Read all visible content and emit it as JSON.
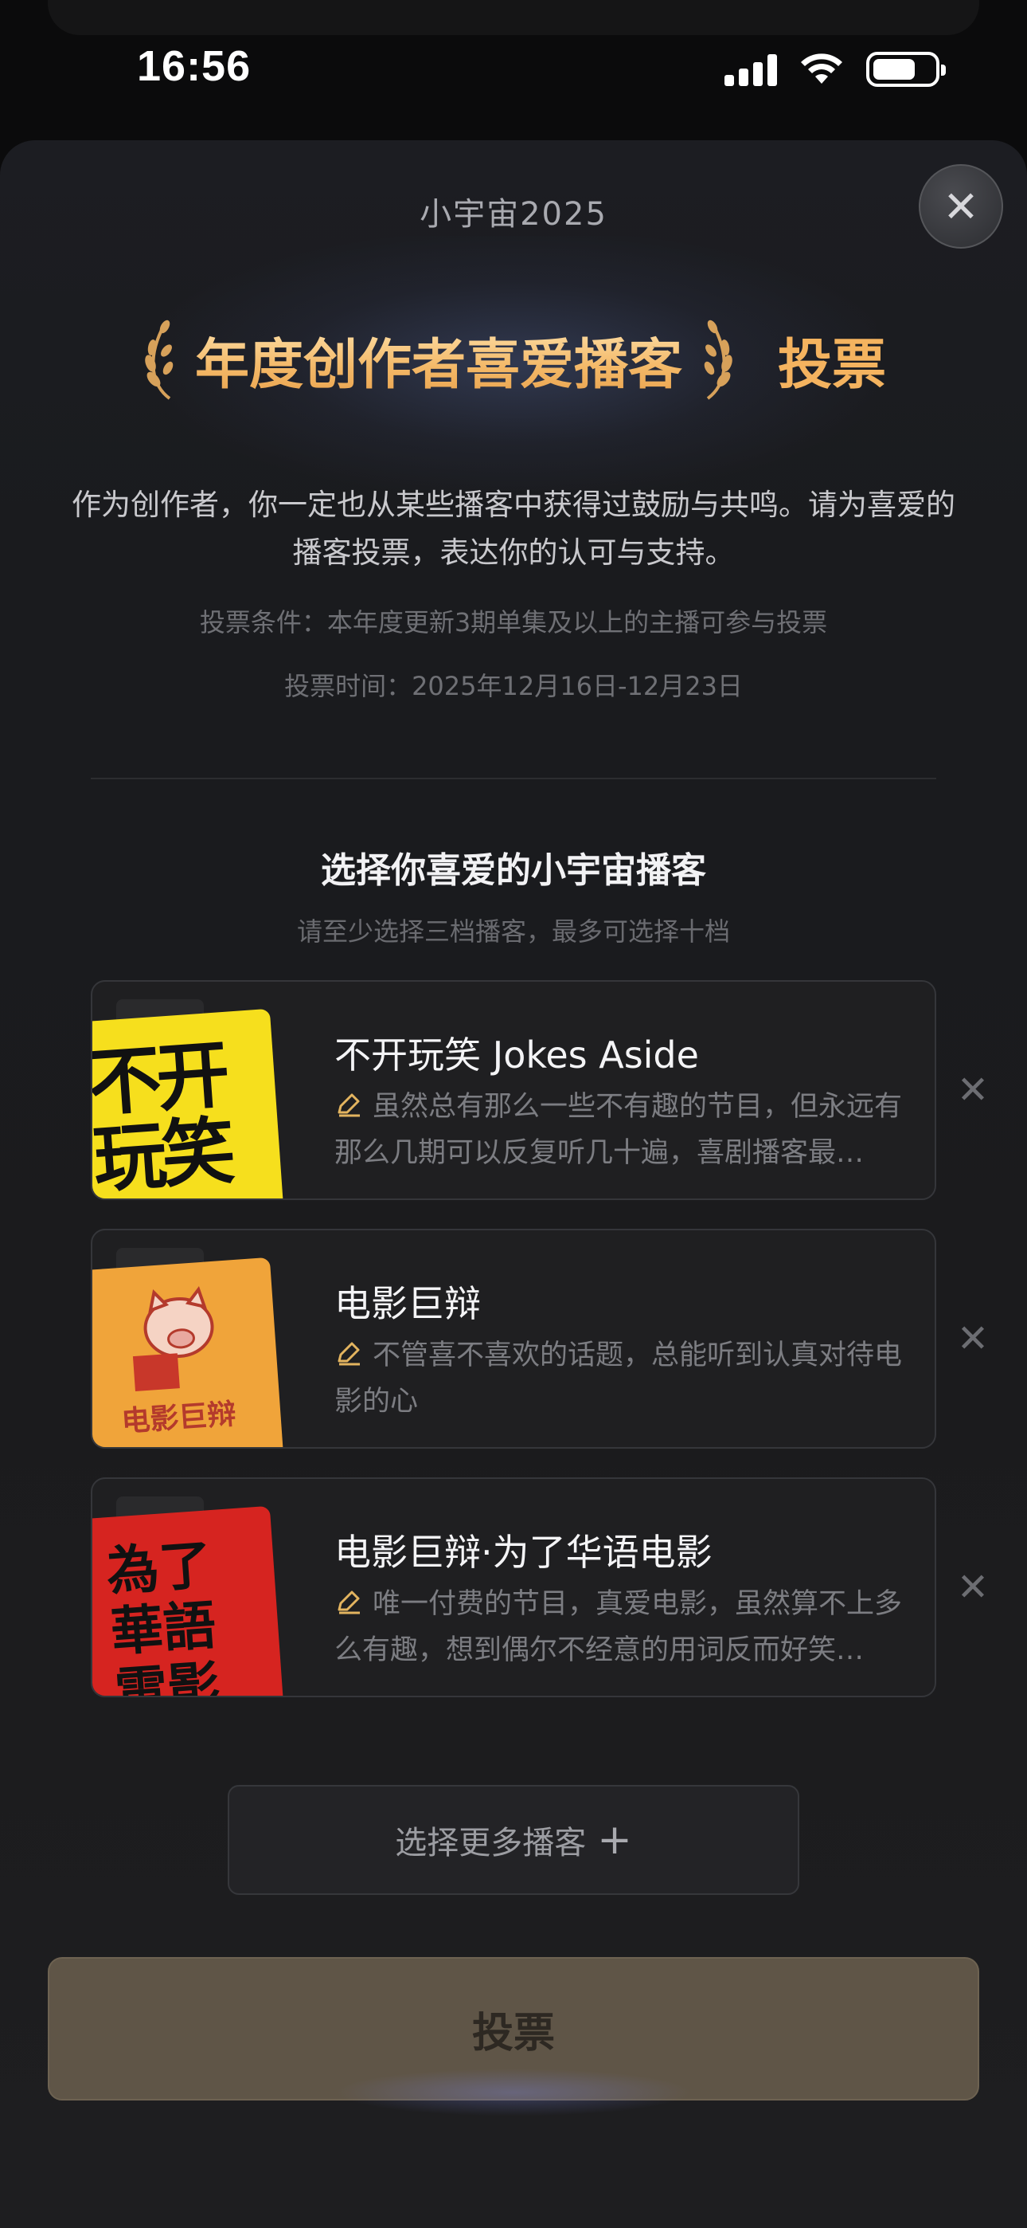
{
  "status_bar": {
    "time": "16:56",
    "icons": [
      "cellular-signal-icon",
      "wifi-icon",
      "battery-icon"
    ]
  },
  "sheet": {
    "brand": "小宇宙2025",
    "close_icon": "✕",
    "title": "年度创作者喜爱播客",
    "title_suffix": "投票",
    "intro": "作为创作者，你一定也从某些播客中获得过鼓励与共鸣。请为喜爱的播客投票，表达你的认可与支持。",
    "condition": "投票条件：本年度更新3期单集及以上的主播可参与投票",
    "time_range": "投票时间：2025年12月16日-12月23日",
    "section_title": "选择你喜爱的小宇宙播客",
    "section_subtitle": "请至少选择三档播客，最多可选择十档",
    "podcasts": [
      {
        "title": "不开玩笑 Jokes Aside",
        "description": "虽然总有那么一些不有趣的节目，但永远有那么几期可以反复听几十遍，喜剧播客最…",
        "cover_text": "不开玩笑"
      },
      {
        "title": "电影巨辩",
        "description": "不管喜不喜欢的话题，总能听到认真对待电影的心",
        "cover_text": "电影巨辩"
      },
      {
        "title": "电影巨辩·为了华语电影",
        "description": "唯一付费的节目，真爱电影，虽然算不上多么有趣，想到偶尔不经意的用词反而好笑…",
        "cover_text": "為了華語電影"
      }
    ],
    "more_button": "选择更多播客",
    "more_button_icon": "+",
    "vote_button": "投票"
  },
  "colors": {
    "accent_gold": "#f4b35f",
    "vote_button_bg": "#5f5547"
  }
}
